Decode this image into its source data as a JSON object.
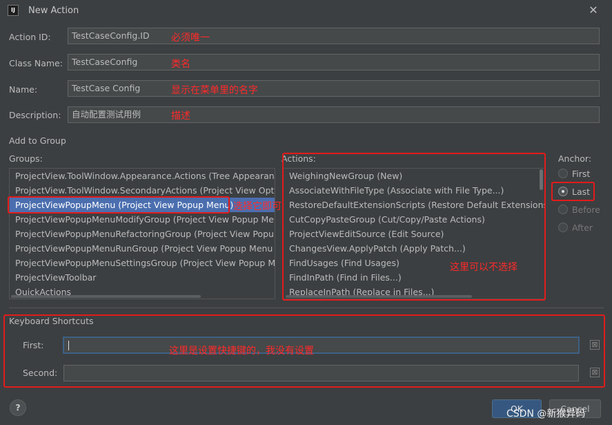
{
  "window": {
    "title": "New Action",
    "icon_text": "IJ"
  },
  "form": {
    "action_id": {
      "label": "Action ID:",
      "value": "TestCaseConfig.ID",
      "note": "必须唯一"
    },
    "class_name": {
      "label": "Class Name:",
      "value": "TestCaseConfig",
      "note": "类名"
    },
    "name": {
      "label": "Name:",
      "value": "TestCase Config",
      "note": "显示在菜单里的名字"
    },
    "description": {
      "label": "Description:",
      "value": "自动配置测试用例",
      "note": "描述"
    }
  },
  "add_to_group": {
    "title": "Add to Group",
    "groups_label": "Groups:",
    "groups": [
      "ProjectView.ToolWindow.Appearance.Actions (Tree Appearance)",
      "ProjectView.ToolWindow.SecondaryActions (Project View Options",
      "ProjectViewPopupMenu (Project View Popup Menu)",
      "ProjectViewPopupMenuModifyGroup (Project View Popup Menu",
      "ProjectViewPopupMenuRefactoringGroup (Project View Popup R",
      "ProjectViewPopupMenuRunGroup (Project View Popup Menu Ru",
      "ProjectViewPopupMenuSettingsGroup (Project View Popup Menu",
      "ProjectViewToolbar",
      "QuickActions"
    ],
    "selected_group_index": 2,
    "groups_note": "选择它即可",
    "actions_label": "Actions:",
    "actions": [
      "WeighingNewGroup (New)",
      "AssociateWithFileType (Associate with File Type...)",
      "RestoreDefaultExtensionScripts (Restore Default Extensions)",
      "CutCopyPasteGroup (Cut/Copy/Paste Actions)",
      "ProjectViewEditSource (Edit Source)",
      "ChangesView.ApplyPatch (Apply Patch...)",
      "FindUsages (Find Usages)",
      "FindInPath (Find in Files...)",
      "ReplaceInPath (Replace in Files...)"
    ],
    "actions_note": "这里可以不选择",
    "anchor_label": "Anchor:",
    "anchors": [
      {
        "label": "First",
        "checked": false,
        "enabled": true
      },
      {
        "label": "Last",
        "checked": true,
        "enabled": true
      },
      {
        "label": "Before",
        "checked": false,
        "enabled": false
      },
      {
        "label": "After",
        "checked": false,
        "enabled": false
      }
    ]
  },
  "shortcuts": {
    "title": "Keyboard Shortcuts",
    "first_label": "First:",
    "first_value": "",
    "second_label": "Second:",
    "second_value": "",
    "note": "这里是设置快捷键的，我没有设置"
  },
  "buttons": {
    "help": "?",
    "ok": "OK",
    "cancel": "Cancel"
  },
  "watermark": "CSDN @新猴异码"
}
